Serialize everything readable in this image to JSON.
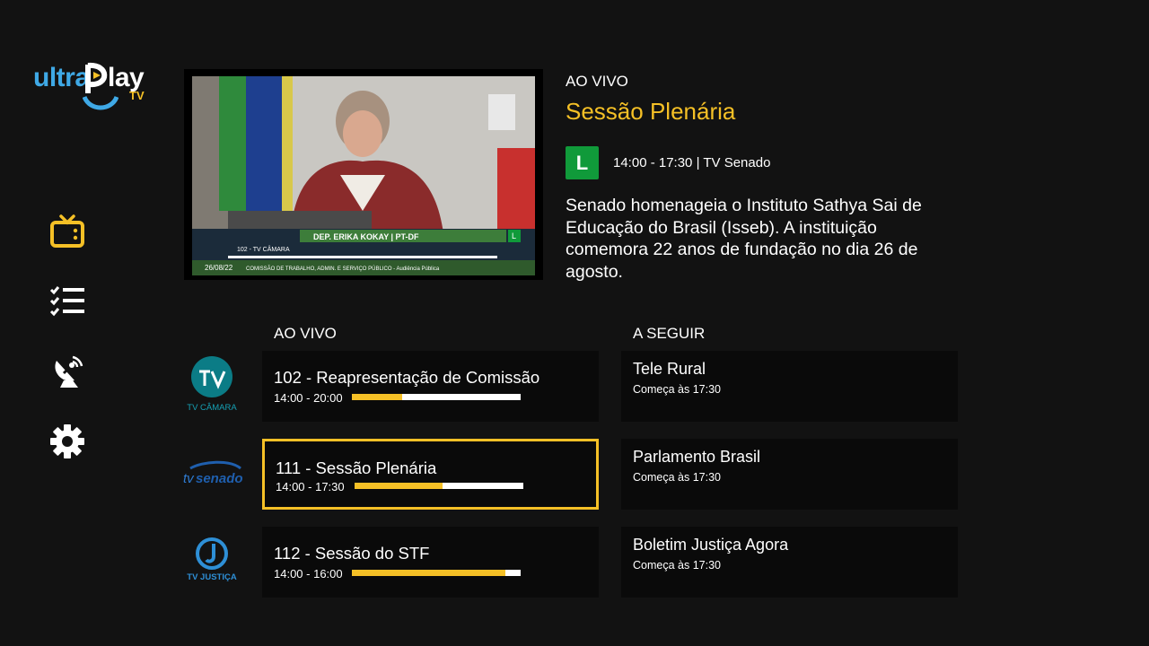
{
  "brand": {
    "logo_word1": "ultra",
    "logo_word2": "lay",
    "logo_sub": "TV",
    "accent": "#f5c026",
    "blue": "#3fa9e6"
  },
  "sidebar": {
    "items": [
      {
        "icon": "tv-icon",
        "active": true
      },
      {
        "icon": "checklist-icon",
        "active": false
      },
      {
        "icon": "satellite-dish-icon",
        "active": false
      },
      {
        "icon": "gear-icon",
        "active": false
      }
    ]
  },
  "preview": {
    "lower_third": "DEP. ERIKA KOKAY | PT-DF",
    "channel_tag": "102 - TV CÂMARA",
    "date": "26/08/22",
    "committee": "COMISSÃO DE TRABALHO, ADMIN. E SERVIÇO PÚBLICO - Audiência Pública"
  },
  "details": {
    "status": "AO VIVO",
    "title": "Sessão Plenária",
    "rating": "L",
    "rating_color": "#109a3a",
    "time_channel": "14:00 - 17:30 | TV Senado",
    "description": "Senado homenageia o Instituto Sathya Sai de Educação do Brasil (Isseb). A instituição comemora 22 anos de fundação no dia 26 de agosto."
  },
  "grid": {
    "now_header": "AO VIVO",
    "next_header": "A SEGUIR",
    "rows": [
      {
        "channel": {
          "name": "TV CÂMARA",
          "mark": "TV"
        },
        "now": {
          "title": "102 - Reapresentação de Comissão",
          "time": "14:00 - 20:00",
          "progress": 0.3
        },
        "next": {
          "title": "Tele Rural",
          "starts": "Começa às 17:30"
        }
      },
      {
        "channel": {
          "name_a": "tv",
          "name_b": "senado"
        },
        "now": {
          "title": "111 - Sessão Plenária",
          "time": "14:00 - 17:30",
          "progress": 0.52
        },
        "next": {
          "title": "Parlamento Brasil",
          "starts": "Começa às 17:30"
        }
      },
      {
        "channel": {
          "name": "TV JUSTIÇA",
          "mark": "J"
        },
        "now": {
          "title": "112 - Sessão do STF",
          "time": "14:00 - 16:00",
          "progress": 0.91
        },
        "next": {
          "title": "Boletim Justiça Agora",
          "starts": "Começa às 17:30"
        }
      }
    ]
  }
}
